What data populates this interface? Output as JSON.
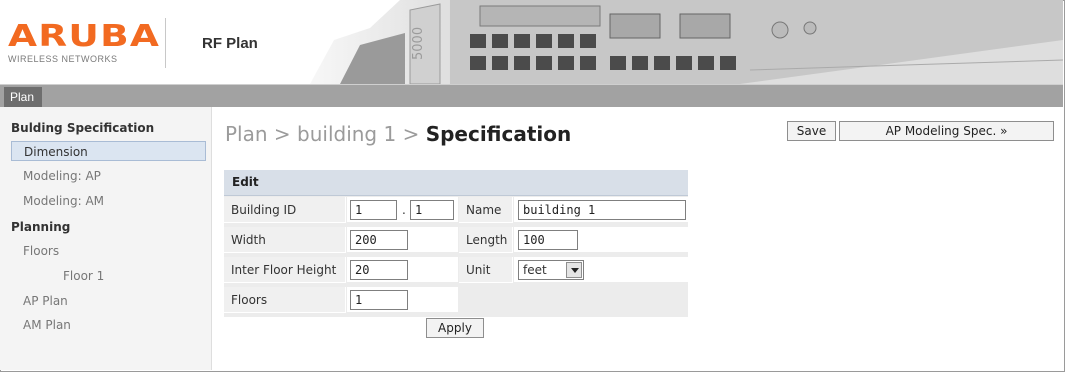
{
  "header": {
    "logo_text": "ARUBA",
    "logo_subtext": "WIRELESS NETWORKS",
    "app_title": "RF Plan",
    "device_label": "5000"
  },
  "topbar": {
    "tab_label": "Plan"
  },
  "sidebar": {
    "section_building": "Bulding Specification",
    "item_dimension": "Dimension",
    "item_modeling_ap": "Modeling: AP",
    "item_modeling_am": "Modeling: AM",
    "section_planning": "Planning",
    "item_floors": "Floors",
    "item_floor1": "Floor 1",
    "item_ap_plan": "AP Plan",
    "item_am_plan": "AM Plan"
  },
  "breadcrumb": {
    "path": "Plan > building 1 > ",
    "current": "Specification"
  },
  "buttons": {
    "save": "Save",
    "ap_modeling": "AP Modeling Spec. »",
    "apply": "Apply"
  },
  "form": {
    "panel_title": "Edit",
    "building_id_label": "Building ID",
    "building_id_part1": "1",
    "building_id_sep": ".",
    "building_id_part2": "1",
    "name_label": "Name",
    "name_value": "building 1",
    "width_label": "Width",
    "width_value": "200",
    "length_label": "Length",
    "length_value": "100",
    "inter_floor_label": "Inter Floor Height",
    "inter_floor_value": "20",
    "unit_label": "Unit",
    "unit_value": "feet",
    "floors_label": "Floors",
    "floors_value": "1"
  }
}
